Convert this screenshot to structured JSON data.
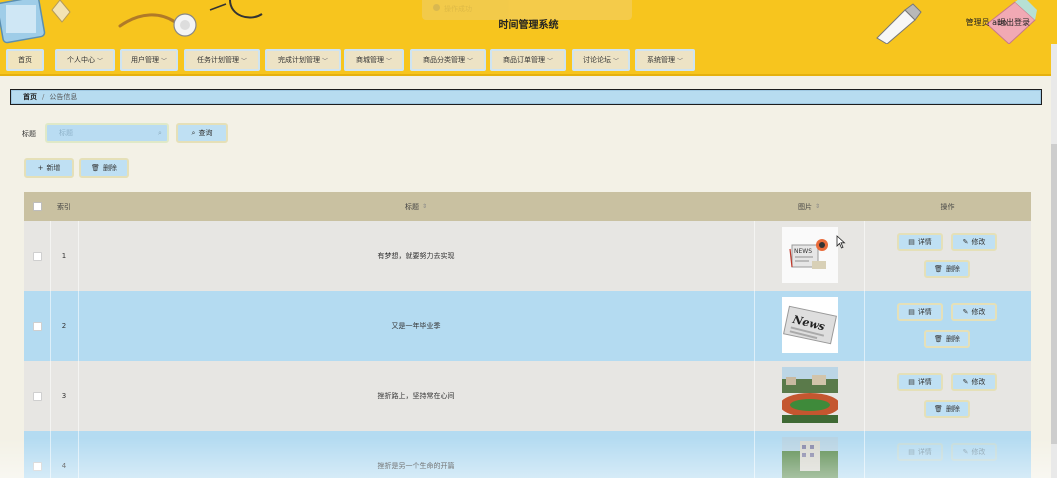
{
  "header": {
    "title": "时间管理系统",
    "ghost_tab": "操作成功",
    "user": "管理员 abo",
    "logout": "退出登录"
  },
  "nav": {
    "items": [
      {
        "label": "首页",
        "has_caret": false
      },
      {
        "label": "个人中心",
        "has_caret": true
      },
      {
        "label": "用户管理",
        "has_caret": true
      },
      {
        "label": "任务计划管理",
        "has_caret": true
      },
      {
        "label": "完成计划管理",
        "has_caret": true
      },
      {
        "label": "商城管理",
        "has_caret": true
      },
      {
        "label": "商品分类管理",
        "has_caret": true
      },
      {
        "label": "商品订单管理",
        "has_caret": true
      },
      {
        "label": "讨论论坛",
        "has_caret": true
      },
      {
        "label": "系统管理",
        "has_caret": true
      }
    ]
  },
  "breadcrumb": {
    "home": "首页",
    "sep": "/",
    "current": "公告信息"
  },
  "search": {
    "label": "标题",
    "placeholder": "标题",
    "query_label": "查询"
  },
  "actions": {
    "add_label": "新增",
    "delete_label": "删除"
  },
  "table": {
    "headers": {
      "index": "索引",
      "title": "标题",
      "image": "图片",
      "ops": "操作"
    },
    "rows": [
      {
        "index": "1",
        "title": "有梦想，就要努力去实现",
        "image": "news-collage"
      },
      {
        "index": "2",
        "title": "又是一年毕业季",
        "image": "news-paper"
      },
      {
        "index": "3",
        "title": "挫折路上，坚持常在心间",
        "image": "campus-track"
      },
      {
        "index": "4",
        "title": "挫折是另一个生命的开篇",
        "image": "campus-building"
      }
    ],
    "op_labels": {
      "detail": "详情",
      "edit": "修改",
      "delete": "删除"
    }
  }
}
